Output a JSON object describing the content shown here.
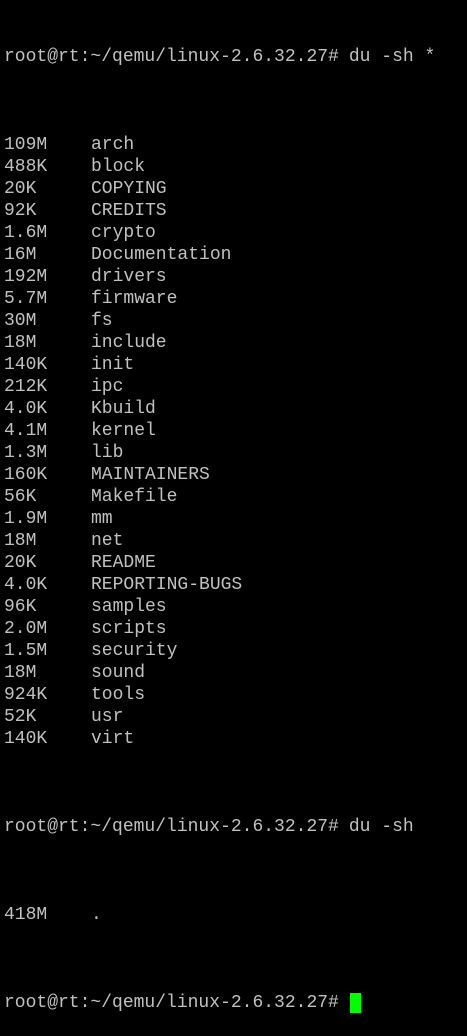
{
  "terminal": {
    "colors": {
      "background": "#000000",
      "text": "#c0c0c0",
      "cursor": "#00ff00"
    },
    "prompt": "root@rt:~/qemu/linux-2.6.32.27#",
    "command1": "du -sh *",
    "entries": [
      {
        "size": "109M",
        "name": "arch"
      },
      {
        "size": "488K",
        "name": "block"
      },
      {
        "size": "20K",
        "name": "COPYING"
      },
      {
        "size": "92K",
        "name": "CREDITS"
      },
      {
        "size": "1.6M",
        "name": "crypto"
      },
      {
        "size": "16M",
        "name": "Documentation"
      },
      {
        "size": "192M",
        "name": "drivers"
      },
      {
        "size": "5.7M",
        "name": "firmware"
      },
      {
        "size": "30M",
        "name": "fs"
      },
      {
        "size": "18M",
        "name": "include"
      },
      {
        "size": "140K",
        "name": "init"
      },
      {
        "size": "212K",
        "name": "ipc"
      },
      {
        "size": "4.0K",
        "name": "Kbuild"
      },
      {
        "size": "4.1M",
        "name": "kernel"
      },
      {
        "size": "1.3M",
        "name": "lib"
      },
      {
        "size": "160K",
        "name": "MAINTAINERS"
      },
      {
        "size": "56K",
        "name": "Makefile"
      },
      {
        "size": "1.9M",
        "name": "mm"
      },
      {
        "size": "18M",
        "name": "net"
      },
      {
        "size": "20K",
        "name": "README"
      },
      {
        "size": "4.0K",
        "name": "REPORTING-BUGS"
      },
      {
        "size": "96K",
        "name": "samples"
      },
      {
        "size": "2.0M",
        "name": "scripts"
      },
      {
        "size": "1.5M",
        "name": "security"
      },
      {
        "size": "18M",
        "name": "sound"
      },
      {
        "size": "924K",
        "name": "tools"
      },
      {
        "size": "52K",
        "name": "usr"
      },
      {
        "size": "140K",
        "name": "virt"
      }
    ],
    "command2": "du -sh",
    "total": {
      "size": "418M",
      "name": "."
    }
  }
}
